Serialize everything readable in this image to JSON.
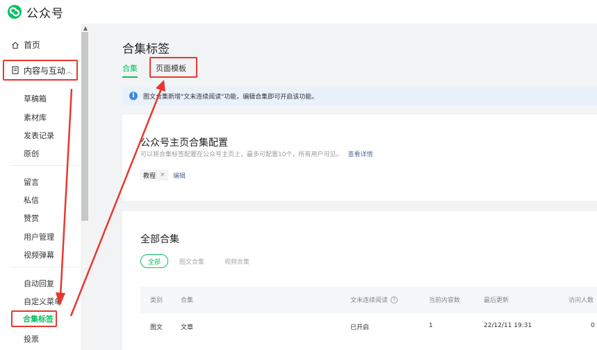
{
  "header": {
    "app_name": "公众号"
  },
  "sidebar": {
    "home": "首页",
    "content_section": "内容与互动",
    "group1": [
      "草稿箱",
      "素材库",
      "发表记录",
      "原创"
    ],
    "group2": [
      "留言",
      "私信",
      "赞赏",
      "用户管理",
      "视频弹幕"
    ],
    "group3": [
      "自动回复",
      "自定义菜单"
    ],
    "active_item": "合集标签",
    "last_item": "投票"
  },
  "page": {
    "title": "合集标签",
    "tabs": [
      "合集",
      "页面模板"
    ]
  },
  "notice": {
    "text": "图文合集新增\"文末连续阅读\"功能，编辑合集即可开启该功能。"
  },
  "config_card": {
    "title": "公众号主页合集配置",
    "description": "可以将合集标签配置在公众号主页上，最多可配置10个，所有用户可见。",
    "detail_link": "查看详情",
    "tag": "教程",
    "tag_close": "×",
    "edit_label": "编辑"
  },
  "all_card": {
    "title": "全部合集",
    "filters": [
      "全部",
      "图文合集",
      "视频合集"
    ],
    "columns": [
      "类别",
      "合集",
      "文末连续阅读",
      "当前内容数",
      "最后更新",
      "访问人数"
    ],
    "question_mark": "?",
    "rows": [
      {
        "type": "图文",
        "name": "文章",
        "continuous": "已开启",
        "count": "1",
        "updated": "22/12/11 19:31",
        "visitors": "0"
      }
    ]
  },
  "colors": {
    "brand": "#07c160",
    "annotation": "#e8372e",
    "link": "#576b95",
    "info": "#3c87e0"
  }
}
